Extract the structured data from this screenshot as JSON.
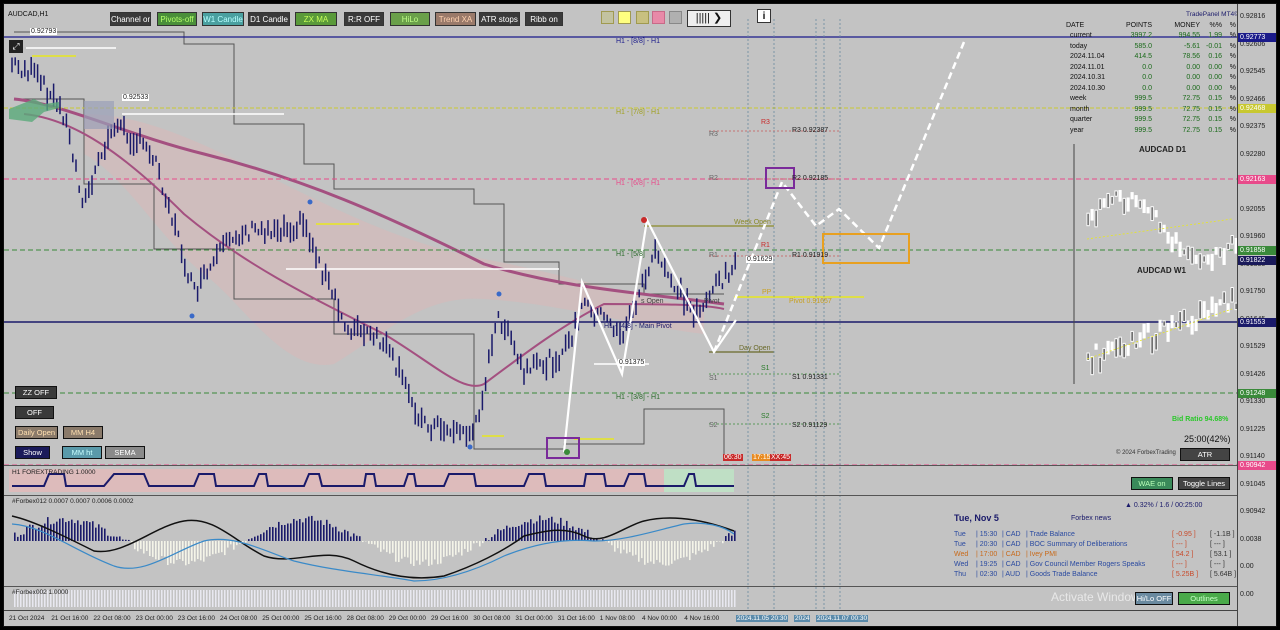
{
  "symbol": "AUDCAD,H1",
  "toolbar": {
    "buttons": [
      {
        "label": "Channel on",
        "bg": "#3a3a3a",
        "fg": "#ffffff"
      },
      {
        "label": "Pivots-off",
        "bg": "#4a8f3a",
        "fg": "#b5ff6a"
      },
      {
        "label": "W1 Candle",
        "bg": "#4aa0a0",
        "fg": "#b8ffff"
      },
      {
        "label": "D1 Candle",
        "bg": "#3a3a3a",
        "fg": "#ffffff"
      },
      {
        "label": "ZX MA",
        "bg": "#5a9a3a",
        "fg": "#c8ff5a"
      },
      {
        "label": "R:R OFF",
        "bg": "#3a3a3a",
        "fg": "#ffffff"
      },
      {
        "label": "HiLo",
        "bg": "#6aa04a",
        "fg": "#c0ff88"
      },
      {
        "label": "Trend XA",
        "bg": "#9a7a6a",
        "fg": "#ffd2b0"
      },
      {
        "label": "ATR stops",
        "bg": "#3a3a3a",
        "fg": "#ffffff"
      },
      {
        "label": "Ribb on",
        "bg": "#3a3a3a",
        "fg": "#ffffff"
      }
    ],
    "swatches": [
      "#c8c080",
      "#ffff80",
      "#e88aa8",
      "#b0b0b0"
    ],
    "bars_icon": "bars-icon",
    "arrow_icon": "arrow-right-icon",
    "info_icon": "info-icon"
  },
  "trade_panel": {
    "title": "TradePanel MT4©",
    "headers": [
      "DATE",
      "POINTS",
      "MONEY",
      "%%",
      "%"
    ],
    "rows": [
      {
        "date": "current",
        "points": "3997.2",
        "money": "994.55",
        "pct": "1.99",
        "unit": "%"
      },
      {
        "date": "today",
        "points": "585.0",
        "money": "-5.61",
        "pct": "-0.01",
        "unit": "%"
      },
      {
        "date": "2024.11.04",
        "points": "414.5",
        "money": "78.56",
        "pct": "0.16",
        "unit": "%"
      },
      {
        "date": "2024.11.01",
        "points": "0.0",
        "money": "0.00",
        "pct": "0.00",
        "unit": "%"
      },
      {
        "date": "2024.10.31",
        "points": "0.0",
        "money": "0.00",
        "pct": "0.00",
        "unit": "%"
      },
      {
        "date": "2024.10.30",
        "points": "0.0",
        "money": "0.00",
        "pct": "0.00",
        "unit": "%"
      },
      {
        "date": "week",
        "points": "999.5",
        "money": "72.75",
        "pct": "0.15",
        "unit": "%"
      },
      {
        "date": "month",
        "points": "999.5",
        "money": "72.75",
        "pct": "0.15",
        "unit": "%"
      },
      {
        "date": "quarter",
        "points": "999.5",
        "money": "72.75",
        "pct": "0.15",
        "unit": "%"
      },
      {
        "date": "year",
        "points": "999.5",
        "money": "72.75",
        "pct": "0.15",
        "unit": "%"
      }
    ]
  },
  "mini_charts": {
    "d1": "AUDCAD D1",
    "w1": "AUDCAD W1"
  },
  "bid_ratio": "Bid Ratio 94.68%",
  "timer": "25:00(42%)",
  "copyright": "© 2024 ForbexTrading",
  "atr_button": "ATR",
  "left_buttons": [
    {
      "label": "ZZ OFF",
      "bg": "#3a3a3a",
      "fg": "#ffffff"
    },
    {
      "label": "OFF",
      "bg": "#3a3a3a",
      "fg": "#ffffff"
    },
    {
      "label": "Daily Open",
      "bg": "#8a7a6a",
      "fg": "#ffe0b0"
    },
    {
      "label": "MM H4",
      "bg": "#8a7a6a",
      "fg": "#ffe0b0"
    },
    {
      "label": "Show",
      "bg": "#1a1a5a",
      "fg": "#ffffff"
    },
    {
      "label": "MM ht",
      "bg": "#5a9aaa",
      "fg": "#c8ffff"
    },
    {
      "label": "SEMA",
      "bg": "#8a8a8a",
      "fg": "#ffffff"
    }
  ],
  "levels": {
    "top_h1": "H1 - [8/8] - H1",
    "h1_78": "H1 - [7/8] - H1",
    "h1_68": "H1 - [6/8] - H1",
    "h1_58": "H1 - [5/8]",
    "h1_48": "H1 - [4/8] - Main Pivot",
    "h1_38": "H1 - [3/8] - H1",
    "r3_tag": "R3",
    "r3_line": "R3 0.92387",
    "r2_tag": "R2",
    "r2_line": "R2 0.92185",
    "r1_tag": "R1",
    "r1_line": "R1 0.91919",
    "week_open": "Week Open",
    "pp_tag": "PP",
    "pivot_line": "Pivot 0.91657",
    "day_open": "Day Open",
    "s1_tag": "S1",
    "s1_line": "S1 0.91331",
    "s2_tag": "S2",
    "s2_line": "S2 0.91129",
    "small_open": "s Open",
    "pivot_small": "Pivot",
    "red_box1": "06:30",
    "orange_box": "17:15",
    "red_box2": "XX:45",
    "hl1": "0.92793",
    "hl2": "0.92533",
    "hl3": "0.91629",
    "hl4": "0.91375"
  },
  "price_axis": {
    "labels": [
      "0.92816",
      "0.92606",
      "0.92545",
      "0.92466",
      "0.92375",
      "0.92280",
      "0.92175",
      "0.92055",
      "0.91960",
      "0.91855",
      "0.91750",
      "0.91645",
      "0.91529",
      "0.91426",
      "0.91330",
      "0.91225",
      "0.91140",
      "0.91045",
      "0.90942",
      "0.0038",
      "0.00",
      "0.00"
    ],
    "tags": [
      {
        "text": "0.92773",
        "bg": "#1a1a8a"
      },
      {
        "text": "0.92468",
        "bg": "#c8c830"
      },
      {
        "text": "0.92163",
        "bg": "#e84a8a"
      },
      {
        "text": "0.91858",
        "bg": "#3a8a3a"
      },
      {
        "text": "0.91822",
        "bg": "#1a1a5a"
      },
      {
        "text": "0.91553",
        "bg": "#1a1a6a"
      },
      {
        "text": "0.91248",
        "bg": "#3a8a3a"
      },
      {
        "text": "0.90942",
        "bg": "#e84a8a"
      }
    ]
  },
  "indicators": {
    "forex": "H1 FOREXTRADING 1.0000",
    "forbex1": "#Forbex012 0.0007 0.0007 0.0006 0.0002",
    "forbex2": "#Forbex002 1.0000"
  },
  "wae_button": "WAE on",
  "toggle_lines": "Toggle Lines",
  "news": {
    "date": "Tue, Nov 5",
    "source": "Forbex news",
    "time_info": "▲ 0.32% / 1.6 / 00:25:00",
    "items": [
      {
        "day": "Tue",
        "time": "15:30",
        "cur": "CAD",
        "event": "Trade Balance",
        "actual": "[ -0.95 ]",
        "prev": "[ -1.1B ]",
        "color": "#2a4aa0"
      },
      {
        "day": "Tue",
        "time": "20:30",
        "cur": "CAD",
        "event": "BOC Summary of Deliberations",
        "actual": "[ --- ]",
        "prev": "[ --- ]",
        "color": "#2a4aa0"
      },
      {
        "day": "Wed",
        "time": "17:00",
        "cur": "CAD",
        "event": "Ivey PMI",
        "actual": "[ 54.2 ]",
        "prev": "[ 53.1 ]",
        "color": "#c86a1a"
      },
      {
        "day": "Wed",
        "time": "19:25",
        "cur": "CAD",
        "event": "Gov Council Member Rogers Speaks",
        "actual": "[ --- ]",
        "prev": "[ --- ]",
        "color": "#2a4aa0"
      },
      {
        "day": "Thu",
        "time": "02:30",
        "cur": "AUD",
        "event": "Goods Trade Balance",
        "actual": "[ 5.25B ]",
        "prev": "[ 5.64B ]",
        "color": "#2a4aa0"
      }
    ]
  },
  "bottom_buttons": {
    "hlo": "Hi/Lo OFF",
    "green": "Outlines"
  },
  "watermark": "Activate Windows",
  "time_axis": [
    "21 Oct 2024",
    "21 Oct 16:00",
    "22 Oct 08:00",
    "23 Oct 00:00",
    "23 Oct 16:00",
    "24 Oct 08:00",
    "25 Oct 00:00",
    "25 Oct 16:00",
    "28 Oct 08:00",
    "29 Oct 00:00",
    "29 Oct 16:00",
    "30 Oct 08:00",
    "31 Oct 00:00",
    "31 Oct 16:00",
    "1 Nov 08:00",
    "4 Nov 00:00",
    "4 Nov 16:00"
  ],
  "time_future": [
    "2024.11.05 20:30",
    "2024",
    "2024.11.07 00:30"
  ]
}
